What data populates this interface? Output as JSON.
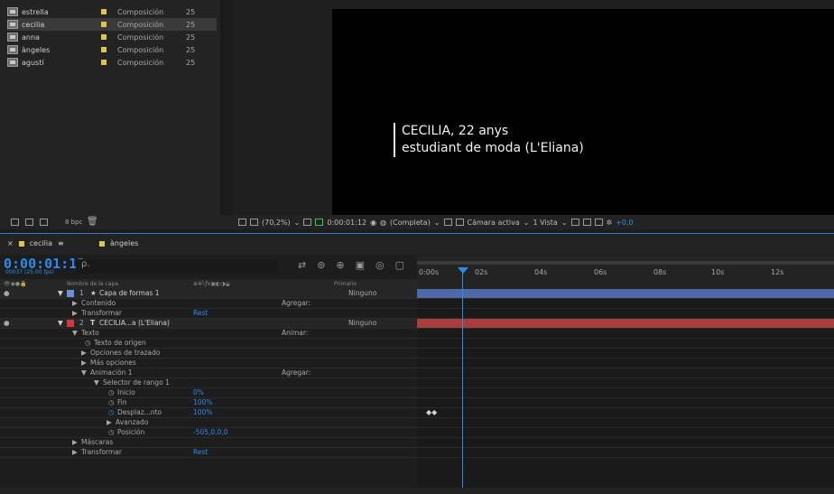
{
  "project": {
    "items": [
      {
        "name": "estrella",
        "type": "Composición",
        "fps": "25"
      },
      {
        "name": "cecilia",
        "type": "Composición",
        "fps": "25",
        "selected": true
      },
      {
        "name": "anna",
        "type": "Composición",
        "fps": "25"
      },
      {
        "name": "àngeles",
        "type": "Composición",
        "fps": "25"
      },
      {
        "name": "agustí",
        "type": "Composición",
        "fps": "25"
      }
    ],
    "bpc": "8 bpc",
    "swatch_color": "#d9c84b"
  },
  "viewer": {
    "caption_line1": "CECILIA, 22 anys",
    "caption_line2": "estudiant de moda (L'Eliana)",
    "zoom": "(70,2%)",
    "timecode": "0:00:01:12",
    "resolution": "(Completa)",
    "camera": "Cámara activa",
    "views": "1 Vista",
    "exposure": "+0,0"
  },
  "tabs": [
    {
      "label": "cecilia",
      "color": "#d9c84b"
    },
    {
      "label": "àngeles",
      "color": "#d9c84b"
    }
  ],
  "timeline": {
    "timecode": "0:00:01:12",
    "timecode_sub": "00037 (25.00 fps)",
    "search_placeholder": "ρ.",
    "col_name": "Nombre de la capa",
    "col_parent": "Primario",
    "ruler": [
      "0:00s",
      "02s",
      "04s",
      "06s",
      "08s",
      "10s",
      "12s"
    ],
    "rows": [
      {
        "num": "1",
        "name": "Capa de formas 1",
        "parent": "Ninguno",
        "color": "#6b8fd6"
      },
      {
        "label": "Contenido",
        "action": "Agregar:"
      },
      {
        "label": "Transformar",
        "value": "Rest"
      },
      {
        "num": "2",
        "name": "CECILIA...a (L'Eliana)",
        "parent": "Ninguno",
        "color": "#d33b3b"
      },
      {
        "label": "Texto",
        "action": "Animar:"
      },
      {
        "label": "Texto de origen"
      },
      {
        "label": "Opciones de trazado"
      },
      {
        "label": "Más opciones"
      },
      {
        "label": "Animación 1",
        "action": "Agregar:"
      },
      {
        "label": "Selector de rango 1"
      },
      {
        "label": "Inicio",
        "value": "0%"
      },
      {
        "label": "Fin",
        "value": "100%"
      },
      {
        "label": "Desplaz...nto",
        "value": "100%"
      },
      {
        "label": "Avanzado"
      },
      {
        "label": "Posición",
        "value": "-505,0,0,0"
      },
      {
        "label": "Máscaras"
      },
      {
        "label": "Transformar",
        "value": "Rest"
      }
    ]
  }
}
